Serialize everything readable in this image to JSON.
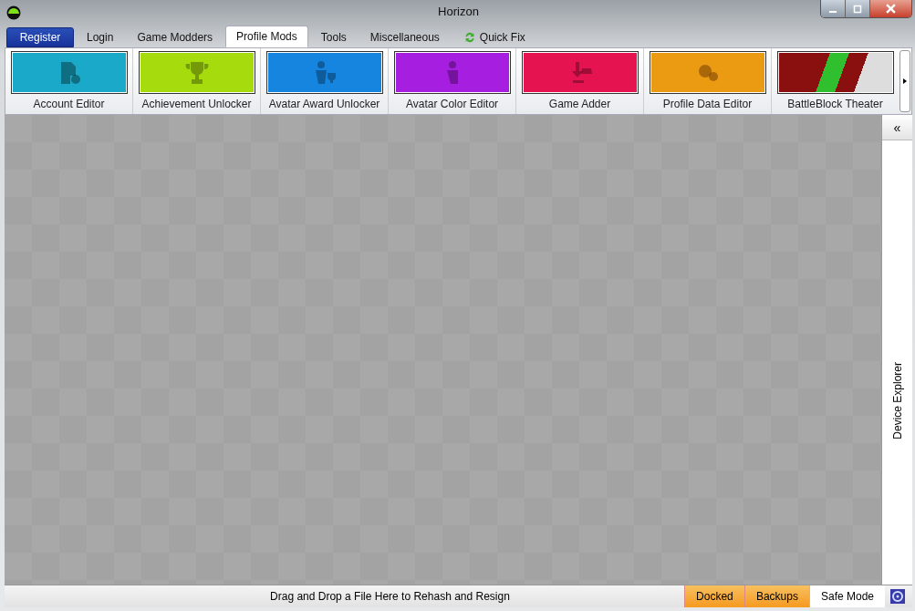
{
  "window": {
    "title": "Horizon"
  },
  "tabs": [
    {
      "label": "Register",
      "kind": "register",
      "selected": false
    },
    {
      "label": "Login",
      "kind": "plain",
      "selected": false
    },
    {
      "label": "Game Modders",
      "kind": "plain",
      "selected": false
    },
    {
      "label": "Profile Mods",
      "kind": "plain",
      "selected": true
    },
    {
      "label": "Tools",
      "kind": "plain",
      "selected": false
    },
    {
      "label": "Miscellaneous",
      "kind": "plain",
      "selected": false
    },
    {
      "label": "Quick Fix",
      "kind": "refresh",
      "selected": false
    }
  ],
  "tiles": [
    {
      "label": "Account Editor",
      "kind": "icon",
      "color": "#1aa9c9"
    },
    {
      "label": "Achievement Unlocker",
      "kind": "icon",
      "color": "#a6dc0e"
    },
    {
      "label": "Avatar Award Unlocker",
      "kind": "icon",
      "color": "#1585e0"
    },
    {
      "label": "Avatar Color Editor",
      "kind": "icon",
      "color": "#a61ee0"
    },
    {
      "label": "Game Adder",
      "kind": "icon",
      "color": "#e5134f"
    },
    {
      "label": "Profile Data Editor",
      "kind": "icon",
      "color": "#eb9b12"
    },
    {
      "label": "BattleBlock Theater",
      "kind": "image",
      "color": "#8a1010"
    }
  ],
  "side_panel": {
    "label": "Device Explorer",
    "collapse": "«"
  },
  "status_bar": {
    "message": "Drag and Drop a File Here to Rehash and Resign",
    "toggles": [
      {
        "label": "Docked",
        "on": true
      },
      {
        "label": "Backups",
        "on": true
      },
      {
        "label": "Safe Mode",
        "on": false
      }
    ]
  }
}
